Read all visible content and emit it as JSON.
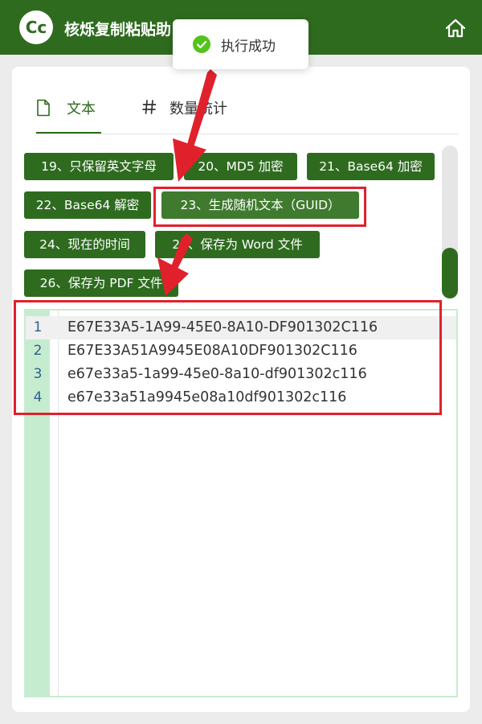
{
  "app": {
    "title": "核烁复制粘贴助",
    "logo_text": "Cc"
  },
  "toast": {
    "message": "执行成功"
  },
  "tabs": [
    {
      "label": "文本",
      "icon": "document-icon",
      "active": true
    },
    {
      "label": "数量统计",
      "icon": "hash-icon",
      "active": false
    }
  ],
  "actions": [
    {
      "label": "19、只保留英文字母"
    },
    {
      "label": "20、MD5 加密"
    },
    {
      "label": "21、Base64 加密"
    },
    {
      "label": "22、Base64 解密"
    },
    {
      "label": "23、生成随机文本（GUID）"
    },
    {
      "label": "24、现在的时间"
    },
    {
      "label": "25、保存为 Word 文件"
    },
    {
      "label": "26、保存为 PDF 文件"
    }
  ],
  "editor": {
    "lines": [
      {
        "number": "1",
        "text": "E67E33A5-1A99-45E0-8A10-DF901302C116"
      },
      {
        "number": "2",
        "text": "E67E33A51A9945E08A10DF901302C116"
      },
      {
        "number": "3",
        "text": "e67e33a5-1a99-45e0-8a10-df901302c116"
      },
      {
        "number": "4",
        "text": "e67e33a51a9945e08a10df901302c116"
      }
    ]
  },
  "colors": {
    "brand_green": "#2e6b1f",
    "success_green": "#52c41a",
    "gutter_green": "#c6ecd0",
    "annotation_red": "#e0212c"
  }
}
